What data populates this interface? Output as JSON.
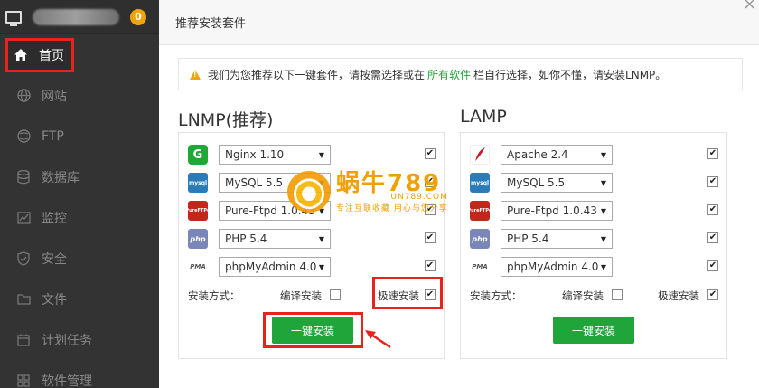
{
  "sidebar": {
    "badge": "0",
    "items": [
      {
        "label": "首页",
        "icon": "home-icon",
        "active": true
      },
      {
        "label": "网站",
        "icon": "globe-icon"
      },
      {
        "label": "FTP",
        "icon": "ftp-globe-icon"
      },
      {
        "label": "数据库",
        "icon": "database-icon"
      },
      {
        "label": "监控",
        "icon": "monitor-chart-icon"
      },
      {
        "label": "安全",
        "icon": "shield-icon"
      },
      {
        "label": "文件",
        "icon": "folder-icon"
      },
      {
        "label": "计划任务",
        "icon": "calendar-icon"
      },
      {
        "label": "软件管理",
        "icon": "app-icon"
      }
    ]
  },
  "modal": {
    "title": "推荐安装套件",
    "notice": {
      "before": "我们为您推荐以下一键套件，请按需选择或在",
      "link": "所有软件",
      "after": "栏自行选择，如你不懂，请安装LNMP。"
    },
    "lnmp": {
      "title": "LNMP(推荐)",
      "rows": [
        {
          "value": "Nginx 1.10",
          "logo": "G",
          "checked": true
        },
        {
          "value": "MySQL 5.5",
          "logo": "mysql",
          "checked": true
        },
        {
          "value": "Pure-Ftpd 1.0.43",
          "logo": "PureFTPd",
          "checked": true
        },
        {
          "value": "PHP 5.4",
          "logo": "php",
          "checked": true
        },
        {
          "value": "phpMyAdmin 4.0",
          "logo": "PMA",
          "checked": true
        }
      ],
      "method_label": "安装方式：",
      "compile_label": "编译安装",
      "compile_checked": false,
      "fast_label": "极速安装",
      "fast_checked": true,
      "install_button": "一键安装"
    },
    "lamp": {
      "title": "LAMP",
      "rows": [
        {
          "value": "Apache 2.4",
          "logo": "feather",
          "checked": true
        },
        {
          "value": "MySQL 5.5",
          "logo": "mysql",
          "checked": true
        },
        {
          "value": "Pure-Ftpd 1.0.43",
          "logo": "PureFTPd",
          "checked": true
        },
        {
          "value": "PHP 5.4",
          "logo": "php",
          "checked": true
        },
        {
          "value": "phpMyAdmin 4.0",
          "logo": "PMA",
          "checked": true
        }
      ],
      "method_label": "安装方式：",
      "compile_label": "编译安装",
      "compile_checked": false,
      "fast_label": "极速安装",
      "fast_checked": true,
      "install_button": "一键安装"
    }
  },
  "watermark": {
    "main": "蜗牛789",
    "domain": "UN789.COM",
    "slogan": "专注互联收藏 用心与您分享"
  },
  "colors": {
    "accent_green": "#20a53a",
    "highlight_red": "#e8231b",
    "sidebar_bg": "#333333",
    "badge": "#f0a30a"
  }
}
